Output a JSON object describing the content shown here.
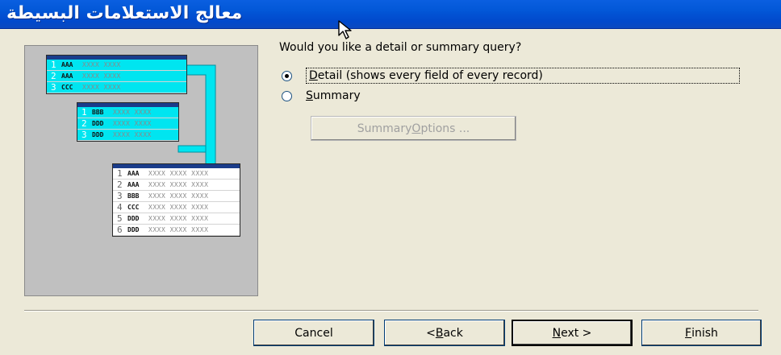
{
  "window": {
    "title": "معالج الاستعلامات البسيطة"
  },
  "illustration": {
    "table_a": [
      {
        "num": "1",
        "code": "AAA",
        "fill": "XXXX XXXX"
      },
      {
        "num": "2",
        "code": "AAA",
        "fill": "XXXX XXXX"
      },
      {
        "num": "3",
        "code": "CCC",
        "fill": "XXXX XXXX"
      }
    ],
    "table_b": [
      {
        "num": "1",
        "code": "BBB",
        "fill": "XXXX XXXX"
      },
      {
        "num": "2",
        "code": "DDD",
        "fill": "XXXX XXXX"
      },
      {
        "num": "3",
        "code": "DDD",
        "fill": "XXXX XXXX"
      }
    ],
    "table_c": [
      {
        "num": "1",
        "code": "AAA",
        "fill": "XXXX XXXX XXXX"
      },
      {
        "num": "2",
        "code": "AAA",
        "fill": "XXXX XXXX XXXX"
      },
      {
        "num": "3",
        "code": "BBB",
        "fill": "XXXX XXXX XXXX"
      },
      {
        "num": "4",
        "code": "CCC",
        "fill": "XXXX XXXX XXXX"
      },
      {
        "num": "5",
        "code": "DDD",
        "fill": "XXXX XXXX XXXX"
      },
      {
        "num": "6",
        "code": "DDD",
        "fill": "XXXX XXXX XXXX"
      }
    ],
    "arrow_color": "#00e5f0"
  },
  "options": {
    "question": "Would you like a detail or summary query?",
    "detail": {
      "access_key": "D",
      "rest": "etail (shows every field of every record)",
      "checked": true
    },
    "summary": {
      "access_key": "S",
      "rest": "ummary",
      "checked": false
    },
    "summary_options": {
      "pre": "Summary ",
      "access_key": "O",
      "rest": "ptions ...",
      "enabled": false
    }
  },
  "buttons": {
    "cancel": "Cancel",
    "back_pre": "< ",
    "back_key": "B",
    "back_rest": "ack",
    "next_key": "N",
    "next_rest": "ext >",
    "finish_key": "F",
    "finish_rest": "inish"
  }
}
